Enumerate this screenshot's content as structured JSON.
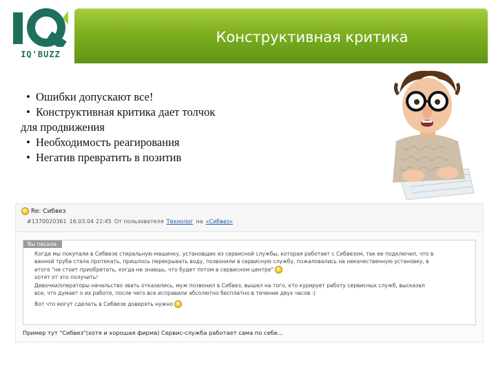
{
  "logo": {
    "mark": "IQ",
    "sub": "IQ'BUZZ"
  },
  "header": {
    "title": "Конструктивная критика"
  },
  "bullets": [
    {
      "text": "Ошибки допускают все!"
    },
    {
      "text": "Конструктивная критика дает толчок",
      "continuation": "для продвижения"
    },
    {
      "text": "Необходимость реагирования"
    },
    {
      "text": "Негатив превратить в позитив"
    }
  ],
  "colors": {
    "accent": "#7fb021",
    "link": "#1a55a8",
    "logo": "#1f6f5f"
  },
  "forum": {
    "re_label": "Re: Сибвез",
    "meta_id": "#1370020361",
    "meta_date": "16.03.04 22:45",
    "meta_prefix": "От пользователя",
    "meta_user": "Технолог",
    "meta_on": "на",
    "meta_link": "«Сибвез»",
    "quote_label": "Вы писали:",
    "quote_lines": [
      "Когда мы покупали в Сибвезе стиральную машинку, установщик из сервисной службы, которая работает с Сибвезом, так ее подключил, что в",
      "ванной труба стала протекать, пришлось перекрывать воду, позвонили в сервисную службу, пожаловались на некачественную установку, в",
      "итоге \"не стоит приобретать, когда не знаешь, что будет потом в сервисном центре\"",
      "хотят от это получить!",
      "Девочки/операторы начальство звать отказались, муж позвонил в Сибвез, вышел на того, кто курирует работу сервисных служб, высказал",
      "все, что думает о их работе, после чего все исправили абсолютно бесплатно в течение двух часов :)",
      "Вот что могут сделать в Сибвезе доверять нужно"
    ],
    "reply": "Пример тут \"Сибвез\"(хотя и хорошая фирма) Сервис-служба работает сама по себе..."
  }
}
